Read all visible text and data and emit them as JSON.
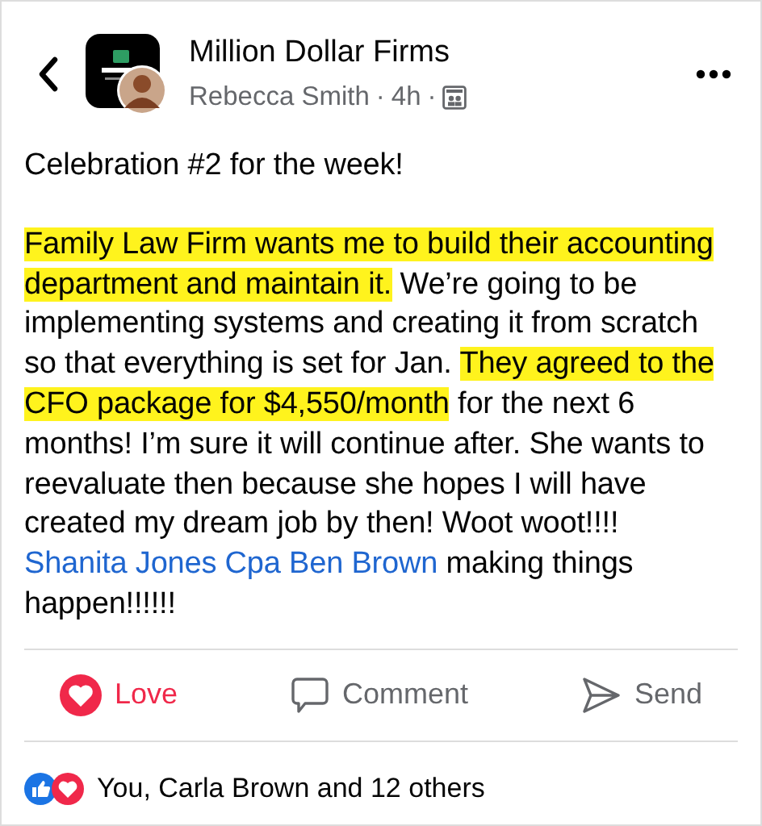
{
  "header": {
    "group_name": "Million Dollar Firms",
    "author": "Rebecca Smith",
    "separator_1": "·",
    "time": "4h",
    "separator_2": "·"
  },
  "post": {
    "paragraphs": [
      [
        {
          "kind": "text",
          "text": "Celebration #2 for the week!",
          "highlighted": false
        }
      ],
      [
        {
          "kind": "text",
          "text": "Family Law Firm wants me to build their accounting department and maintain it.",
          "highlighted": true
        },
        {
          "kind": "text",
          "text": " We’re going to be implementing systems and creating it from scratch so that everything is set for Jan. ",
          "highlighted": false
        },
        {
          "kind": "text",
          "text": "They agreed to the CFO package for $4,550/month",
          "highlighted": true
        },
        {
          "kind": "text",
          "text": " for the next 6 months! I’m sure it will continue after. She wants to reevaluate then because she hopes I will have created my dream job by then! Woot woot!!!! ",
          "highlighted": false
        },
        {
          "kind": "link",
          "text": "Shanita Jones Cpa",
          "highlighted": false
        },
        {
          "kind": "link",
          "text": "Ben Brown",
          "highlighted": false
        },
        {
          "kind": "text",
          "text": " making things happen!!!!!!",
          "highlighted": false
        }
      ]
    ]
  },
  "actions": [
    {
      "kind": "love",
      "label": "Love",
      "selected": true
    },
    {
      "kind": "comment",
      "label": "Comment",
      "selected": false
    },
    {
      "kind": "send",
      "label": "Send",
      "selected": false
    }
  ],
  "reactions": {
    "summary": "You, Carla Brown and 12 others"
  }
}
